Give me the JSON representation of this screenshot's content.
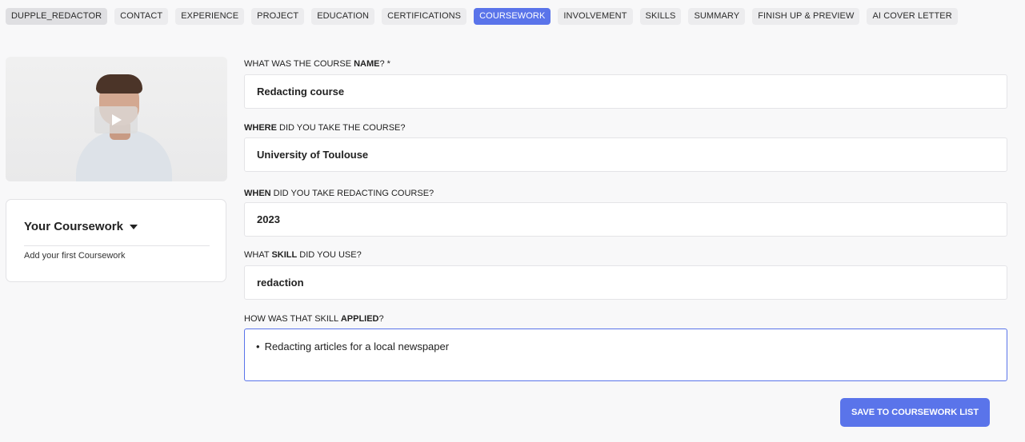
{
  "tabs": [
    {
      "label": "DUPPLE_REDACTOR"
    },
    {
      "label": "CONTACT"
    },
    {
      "label": "EXPERIENCE"
    },
    {
      "label": "PROJECT"
    },
    {
      "label": "EDUCATION"
    },
    {
      "label": "CERTIFICATIONS"
    },
    {
      "label": "COURSEWORK"
    },
    {
      "label": "INVOLVEMENT"
    },
    {
      "label": "SKILLS"
    },
    {
      "label": "SUMMARY"
    },
    {
      "label": "FINISH UP & PREVIEW"
    },
    {
      "label": "AI COVER LETTER"
    }
  ],
  "active_tab": "COURSEWORK",
  "sidebar": {
    "card_title": "Your Coursework",
    "card_hint": "Add your first Coursework"
  },
  "form": {
    "course_name": {
      "label_pre": "WHAT WAS THE COURSE ",
      "label_bold": "NAME",
      "label_post": "? *",
      "value": "Redacting course"
    },
    "where": {
      "label_pre": "",
      "label_bold": "WHERE",
      "label_post": " DID YOU TAKE THE COURSE?",
      "value": "University of Toulouse"
    },
    "when": {
      "label_pre": "",
      "label_bold": "WHEN",
      "label_post": " DID YOU TAKE REDACTING COURSE?",
      "value": "2023"
    },
    "skill": {
      "label_pre": "WHAT ",
      "label_bold": "SKILL",
      "label_post": " DID YOU USE?",
      "value": "redaction"
    },
    "applied": {
      "label_pre": "HOW WAS THAT SKILL ",
      "label_bold": "APPLIED",
      "label_post": "?",
      "bullet": "•",
      "value": "Redacting articles for a local newspaper"
    },
    "save_label": "SAVE TO COURSEWORK LIST"
  },
  "colors": {
    "accent": "#5a74ea",
    "background": "#f8f8f9"
  }
}
